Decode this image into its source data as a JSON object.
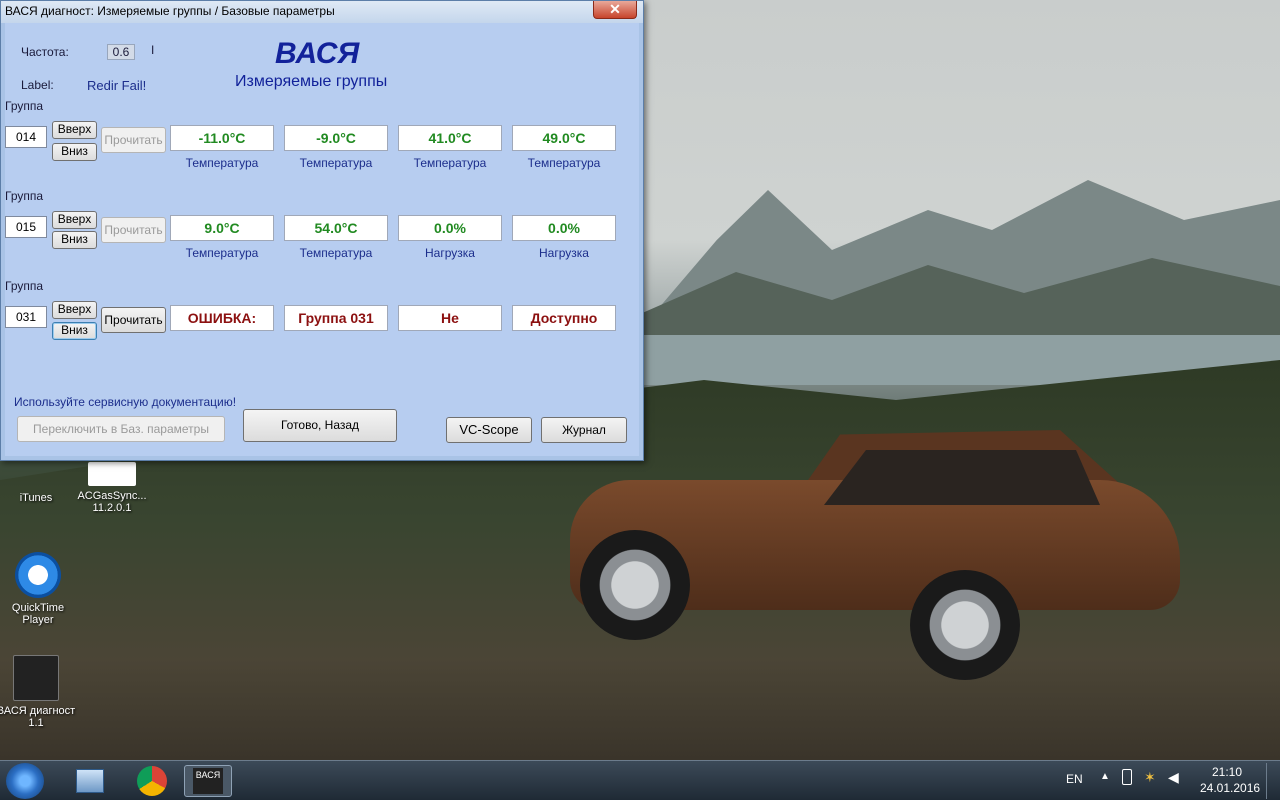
{
  "window": {
    "title": "ВАСЯ диагност: Измеряемые группы / Базовые параметры",
    "close_glyph": "✕"
  },
  "header": {
    "freq_label": "Частота:",
    "freq_value": "0.6",
    "freq_tick": "I",
    "label_label": "Label:",
    "label_value": "Redir Fail!",
    "app_title": "ВАСЯ",
    "subtitle": "Измеряемые группы"
  },
  "groups": [
    {
      "label": "Группа",
      "number": "014",
      "up": "Вверх",
      "down": "Вниз",
      "read": "Прочитать",
      "values": [
        "-11.0°C",
        "-9.0°C",
        "41.0°C",
        "49.0°C"
      ],
      "units": [
        "Температура",
        "Температура",
        "Температура",
        "Температура"
      ]
    },
    {
      "label": "Группа",
      "number": "015",
      "up": "Вверх",
      "down": "Вниз",
      "read": "Прочитать",
      "values": [
        "9.0°C",
        "54.0°C",
        "0.0%",
        "0.0%"
      ],
      "units": [
        "Температура",
        "Температура",
        "Нагрузка",
        "Нагрузка"
      ]
    },
    {
      "label": "Группа",
      "number": "031",
      "up": "Вверх",
      "down": "Вниз",
      "read": "Прочитать",
      "values": [
        "ОШИБКА:",
        "Группа 031",
        "Не",
        "Доступно"
      ],
      "units": [
        "",
        "",
        "",
        ""
      ]
    }
  ],
  "footer": {
    "note": "Используйте сервисную документацию!",
    "switch_btn": "Переключить в Баз. параметры",
    "done_btn": "Готово, Назад",
    "scope_btn": "VC-Scope",
    "log_btn": "Журнал"
  },
  "desktop_icons": [
    {
      "label": "iTunes",
      "icon": "itunes-icon"
    },
    {
      "label": "ACGasSync... 11.2.0.1",
      "icon": "acgassync-icon"
    },
    {
      "label": "QuickTime Player",
      "icon": "quicktime-icon"
    },
    {
      "label": "ВАСЯ диагност 1.1",
      "icon": "vasya-icon"
    }
  ],
  "taskbar": {
    "lang": "EN",
    "time": "21:10",
    "date": "24.01.2016",
    "pinned": [
      "explorer-icon",
      "chrome-icon",
      "vasya-icon"
    ],
    "vasya_logo": "ВАСЯ"
  }
}
